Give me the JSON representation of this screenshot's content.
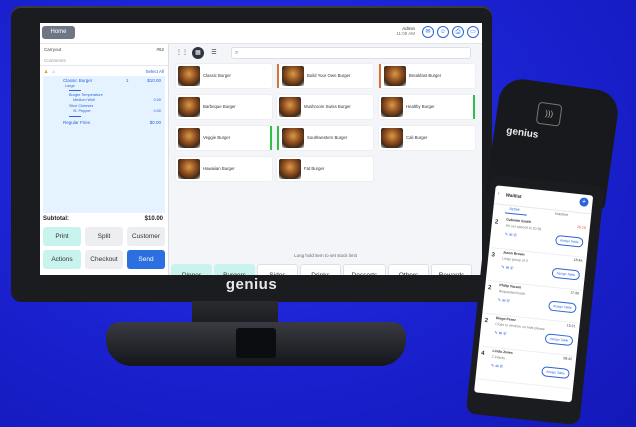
{
  "colors": {
    "background": "#1d24d9",
    "accent": "#2c63d8",
    "mint": "#c9f3ee",
    "send": "#2c6fe0"
  },
  "pos": {
    "topbar": {
      "home": "Home",
      "admin": "Admin",
      "time": "11:09 AM"
    },
    "order": {
      "type": "Carryout",
      "number": "#62",
      "comments_placeholder": "Comments",
      "select_all": "Select All",
      "items": [
        {
          "name": "Classic Burger",
          "qty": "1",
          "price": "$10.00",
          "size": "Large"
        },
        {
          "mod": "Burger Temperature"
        },
        {
          "mod": "Medium Well",
          "price": "0.00"
        },
        {
          "mod": "Slice Cheeses"
        },
        {
          "mod": "Sl. Pepper",
          "price": "0.00"
        },
        {
          "name": "Regular Fries",
          "price": "$0.00"
        }
      ],
      "subtotal_label": "Subtotal:",
      "subtotal": "$10.00"
    },
    "buttons": [
      "Print",
      "Split",
      "Customer",
      "Actions",
      "Checkout",
      "Send"
    ],
    "search_placeholder": "",
    "menu": [
      {
        "name": "Classic Burger",
        "bar": ""
      },
      {
        "name": "Build Your Own Burger",
        "bar": "#d7743a"
      },
      {
        "name": "Breakfast Burger",
        "bar": "#d7743a"
      },
      {
        "name": "Barbeque Burger",
        "bar": ""
      },
      {
        "name": "Mushroom Swiss Burger",
        "bar": ""
      },
      {
        "name": "Healthy Burger",
        "bar": "#2fbf4a"
      },
      {
        "name": "Veggie Burger",
        "bar": "#2fbf4a"
      },
      {
        "name": "Southwestern Burger",
        "bar": "#2fbf4a"
      },
      {
        "name": "Cali Burger",
        "bar": ""
      },
      {
        "name": "Hawaiian Burger",
        "bar": ""
      },
      {
        "name": "Fat Burger",
        "bar": ""
      }
    ],
    "hint": "Long hold item to set stock limit",
    "categories": [
      "Dinner",
      "Burgers",
      "Sides",
      "Drinks",
      "Desserts",
      "Others",
      "Rewards"
    ]
  },
  "brand": {
    "monitor_logo": "genius",
    "handheld_logo": "genius"
  },
  "handheld": {
    "title": "Waitlist",
    "tabs": [
      "Active",
      "Inactive"
    ],
    "entries": [
      {
        "num": "2",
        "name": "Gabriele Smith",
        "sub": "It's our special to 10:39",
        "time": "25:10",
        "assign": "Assign Table"
      },
      {
        "num": "3",
        "name": "Jason Brown",
        "sub": "Large group of 3",
        "time": "18:45",
        "assign": "Assign Table"
      },
      {
        "num": "2",
        "name": "Philip Vacaro",
        "sub": "Requested booth",
        "time": "17:30",
        "assign": "Assign Table"
      },
      {
        "num": "2",
        "name": "Diego Perez",
        "sub": "Close to window, no kids please",
        "time": "15:21",
        "assign": "Assign Table"
      },
      {
        "num": "4",
        "name": "Linda Jones",
        "sub": "2 infants",
        "time": "08:42",
        "assign": "Assign Table"
      }
    ]
  }
}
